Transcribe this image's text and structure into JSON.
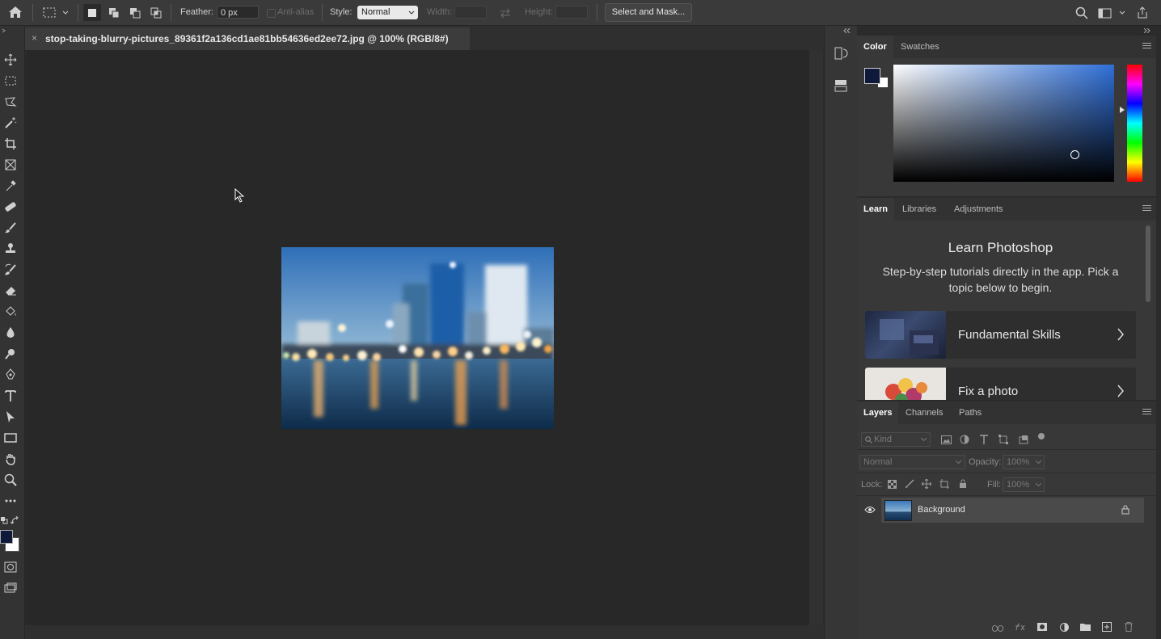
{
  "options_bar": {
    "feather_label": "Feather:",
    "feather_value": "0 px",
    "anti_alias_label": "Anti-alias",
    "style_label": "Style:",
    "style_value": "Normal",
    "width_label": "Width:",
    "height_label": "Height:",
    "select_mask_label": "Select and Mask..."
  },
  "document": {
    "tab_title": "stop-taking-blurry-pictures_89361f2a136cd1ae81bb54636ed2ee72.jpg @ 100% (RGB/8#)",
    "close_glyph": "×"
  },
  "color_panel": {
    "tabs": [
      "Color",
      "Swatches"
    ],
    "active_tab": "Color",
    "foreground_color": "#0f1a3a",
    "background_color": "#ffffff",
    "hue_color": "#2f6fd8"
  },
  "learn_panel": {
    "tabs": [
      "Learn",
      "Libraries",
      "Adjustments"
    ],
    "active_tab": "Learn",
    "title": "Learn Photoshop",
    "description": "Step-by-step tutorials directly in the app. Pick a topic below to begin.",
    "cards": [
      {
        "title": "Fundamental Skills"
      },
      {
        "title": "Fix a photo"
      }
    ]
  },
  "layers_panel": {
    "tabs": [
      "Layers",
      "Channels",
      "Paths"
    ],
    "active_tab": "Layers",
    "filter_placeholder": "Kind",
    "blend_mode": "Normal",
    "opacity_label": "Opacity:",
    "opacity_value": "100%",
    "lock_label": "Lock:",
    "fill_label": "Fill:",
    "fill_value": "100%",
    "layers": [
      {
        "name": "Background",
        "visible": true,
        "locked": true
      }
    ]
  },
  "colors": {
    "accent": "#e6e6e6",
    "canvas_bg": "#282828",
    "panel_bg": "#383838"
  }
}
